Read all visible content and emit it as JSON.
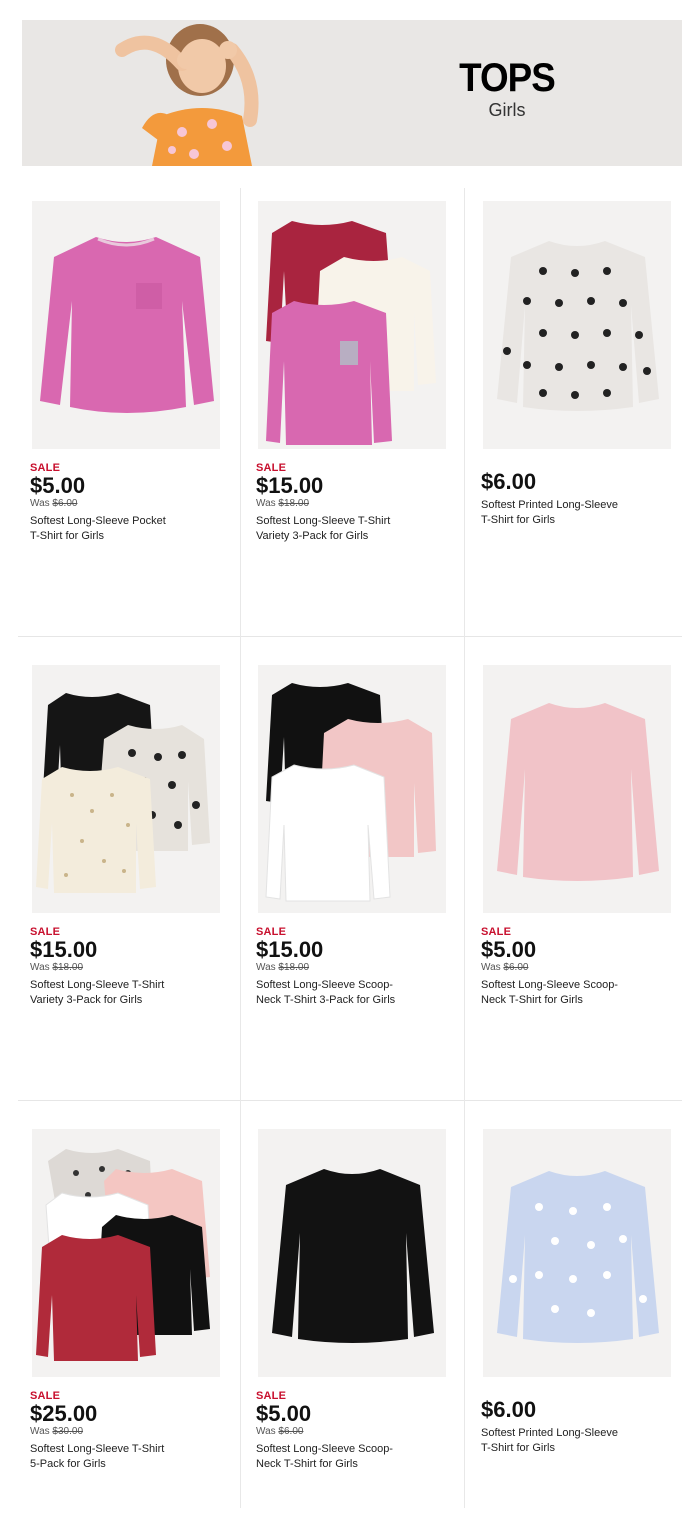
{
  "banner": {
    "title": "TOPS",
    "subtitle": "Girls"
  },
  "colors": {
    "sale": "#c8102e",
    "banner_bg": "#e9e7e5"
  },
  "products": [
    {
      "sale_label": "SALE",
      "price": "$5.00",
      "was_prefix": "Was ",
      "was_price": "$6.00",
      "title_line1": "Softest Long-Sleeve Pocket",
      "title_line2": "T-Shirt for Girls"
    },
    {
      "sale_label": "SALE",
      "price": "$15.00",
      "was_prefix": "Was ",
      "was_price": "$18.00",
      "title_line1": "Softest Long-Sleeve T-Shirt",
      "title_line2": "Variety 3-Pack for Girls"
    },
    {
      "sale_label": "",
      "price": "$6.00",
      "was_prefix": "",
      "was_price": "",
      "title_line1": "Softest Printed Long-Sleeve",
      "title_line2": "T-Shirt for Girls"
    },
    {
      "sale_label": "SALE",
      "price": "$15.00",
      "was_prefix": "Was ",
      "was_price": "$18.00",
      "title_line1": "Softest Long-Sleeve T-Shirt",
      "title_line2": "Variety 3-Pack for Girls"
    },
    {
      "sale_label": "SALE",
      "price": "$15.00",
      "was_prefix": "Was ",
      "was_price": "$18.00",
      "title_line1": "Softest Long-Sleeve Scoop-",
      "title_line2": "Neck T-Shirt 3-Pack for Girls"
    },
    {
      "sale_label": "SALE",
      "price": "$5.00",
      "was_prefix": "Was ",
      "was_price": "$6.00",
      "title_line1": "Softest Long-Sleeve Scoop-",
      "title_line2": "Neck T-Shirt for Girls"
    },
    {
      "sale_label": "SALE",
      "price": "$25.00",
      "was_prefix": "Was ",
      "was_price": "$30.00",
      "title_line1": "Softest Long-Sleeve T-Shirt",
      "title_line2": "5-Pack for Girls"
    },
    {
      "sale_label": "SALE",
      "price": "$5.00",
      "was_prefix": "Was ",
      "was_price": "$6.00",
      "title_line1": "Softest Long-Sleeve Scoop-",
      "title_line2": "Neck T-Shirt for Girls"
    },
    {
      "sale_label": "",
      "price": "$6.00",
      "was_prefix": "",
      "was_price": "",
      "title_line1": "Softest Printed Long-Sleeve",
      "title_line2": "T-Shirt for Girls"
    }
  ]
}
